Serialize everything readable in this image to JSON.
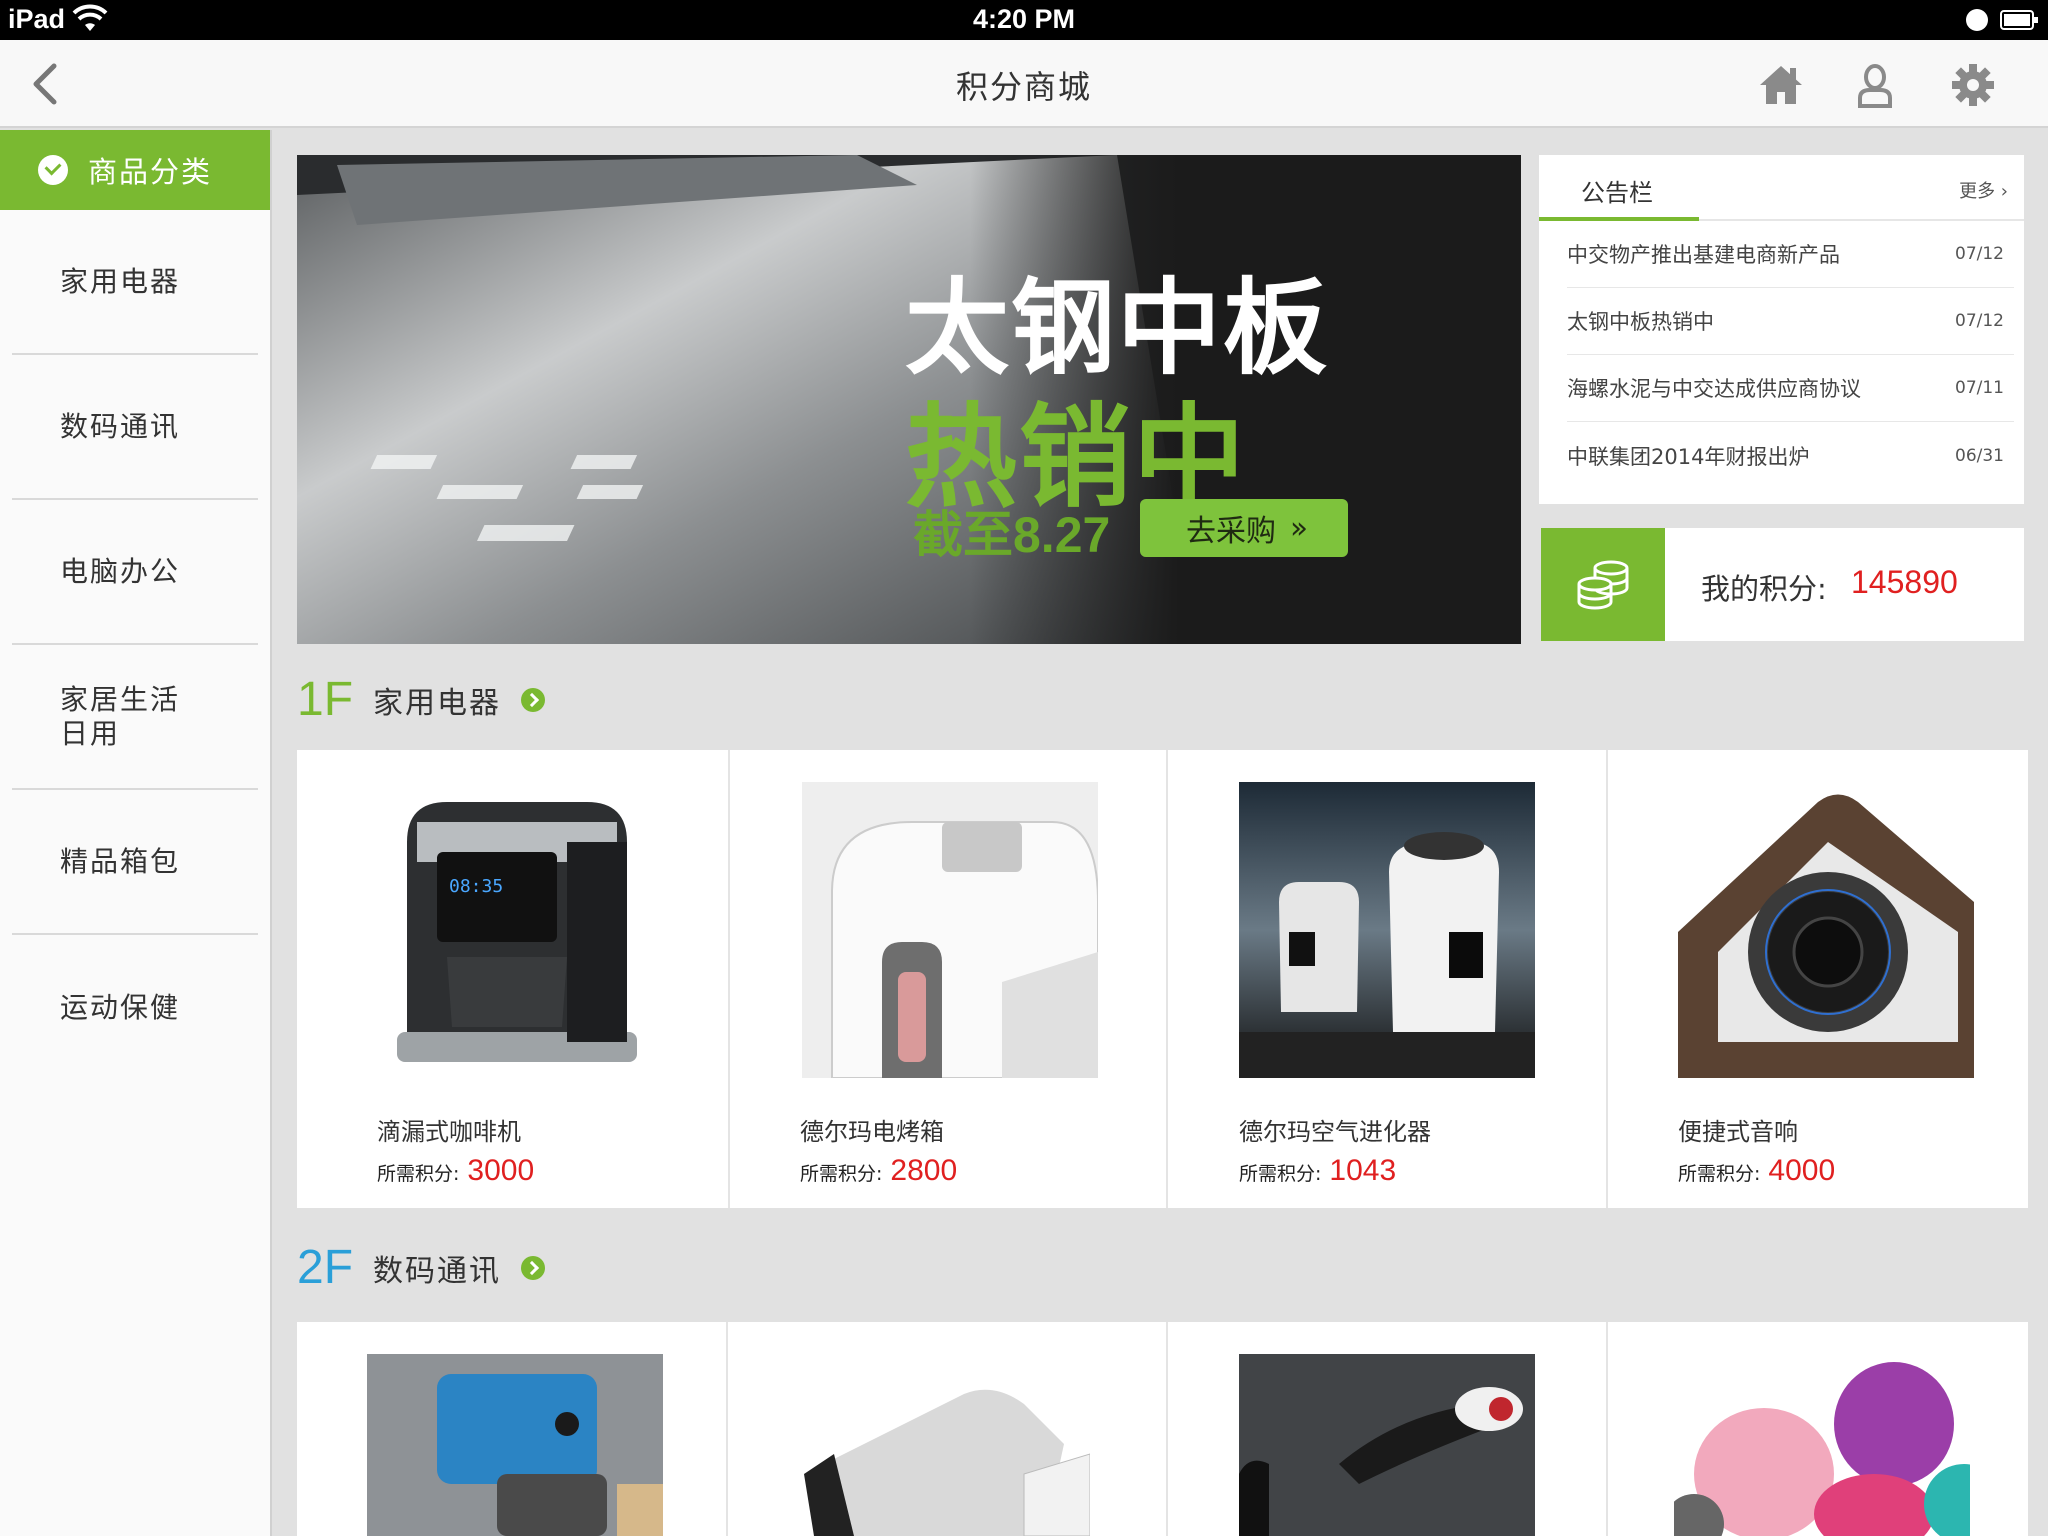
{
  "status_bar": {
    "device": "iPad",
    "time": "4:20 PM"
  },
  "nav": {
    "title": "积分商城"
  },
  "sidebar": {
    "header": "商品分类",
    "items": [
      {
        "label": "家用电器"
      },
      {
        "label": "数码通讯"
      },
      {
        "label": "电脑办公"
      },
      {
        "label": "家居生活\n日用"
      },
      {
        "label": "精品箱包"
      },
      {
        "label": "运动保健"
      }
    ]
  },
  "banner": {
    "line1": "太钢中板",
    "line2": "热销中",
    "deadline": "截至8.27",
    "button": "去采购"
  },
  "notice": {
    "title": "公告栏",
    "more": "更多 ›",
    "items": [
      {
        "text": "中交物产推出基建电商新产品",
        "date": "07/12"
      },
      {
        "text": "太钢中板热销中",
        "date": "07/12"
      },
      {
        "text": "海螺水泥与中交达成供应商协议",
        "date": "07/11"
      },
      {
        "text": "中联集团2014年财报出炉",
        "date": "06/31"
      }
    ]
  },
  "points": {
    "label": "我的积分:",
    "value": "145890"
  },
  "price_label": "所需积分:",
  "floors": [
    {
      "num": "1F",
      "name": "家用电器",
      "color": "#7ab931",
      "products": [
        {
          "name": "滴漏式咖啡机",
          "points": "3000",
          "icon": "coffee-maker"
        },
        {
          "name": "德尔玛电烤箱",
          "points": "2800",
          "icon": "toaster-oven"
        },
        {
          "name": "德尔玛空气进化器",
          "points": "1043",
          "icon": "air-purifier"
        },
        {
          "name": "便捷式音响",
          "points": "4000",
          "icon": "speaker"
        }
      ]
    },
    {
      "num": "2F",
      "name": "数码通讯",
      "color": "#2a9fd8",
      "products": [
        {
          "icon": "smartphone"
        },
        {
          "icon": "usb-drive"
        },
        {
          "icon": "bluetooth-headset"
        },
        {
          "icon": "face-brush"
        }
      ]
    }
  ],
  "colors": {
    "accent": "#7ab931",
    "price": "#e02020",
    "floor2": "#2a9fd8"
  }
}
